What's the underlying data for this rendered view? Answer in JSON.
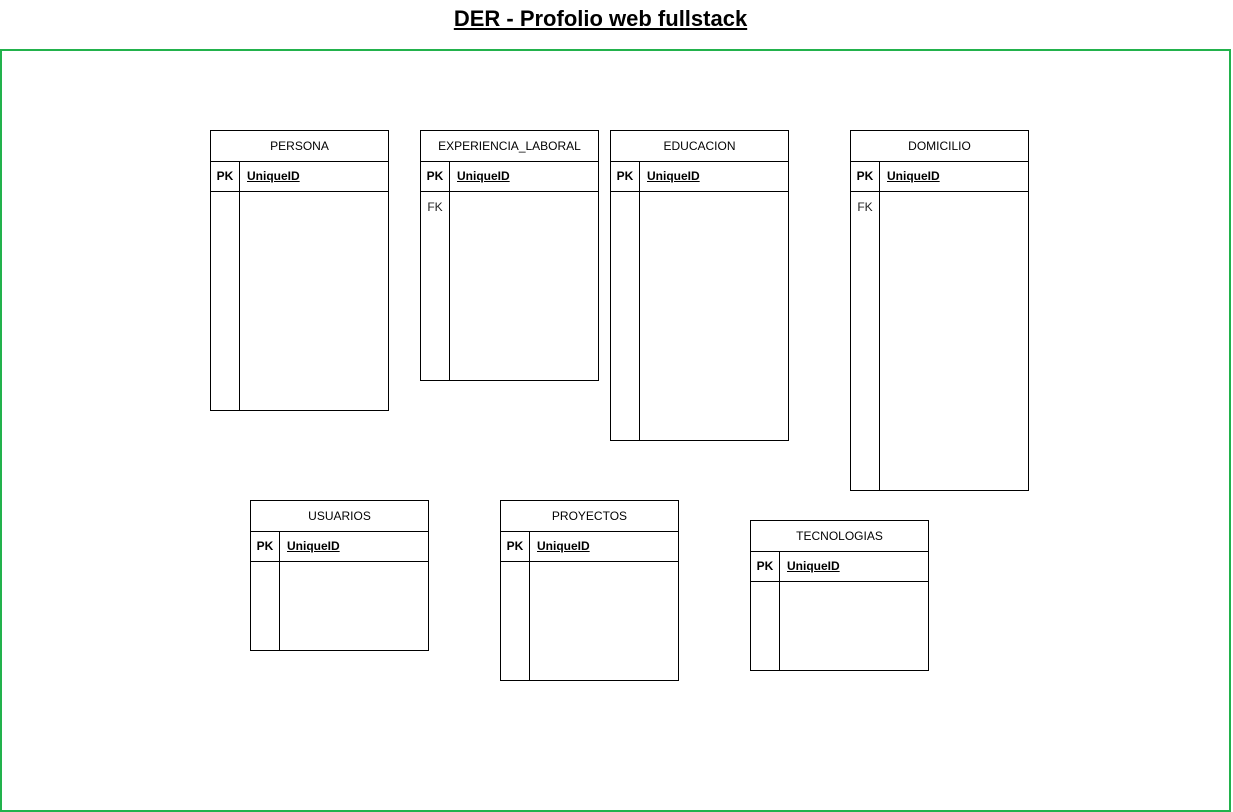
{
  "title": "DER - Profolio web fullstack",
  "colors": {
    "frame": "#22b24c",
    "stroke": "#000000"
  },
  "entities": {
    "persona": {
      "name": "PERSONA",
      "pk_label": "PK",
      "pk_field": "UniqueID",
      "fk_label": ""
    },
    "experiencia": {
      "name": "EXPERIENCIA_LABORAL",
      "pk_label": "PK",
      "pk_field": "UniqueID",
      "fk_label": "FK"
    },
    "educacion": {
      "name": "EDUCACION",
      "pk_label": "PK",
      "pk_field": "UniqueID",
      "fk_label": ""
    },
    "domicilio": {
      "name": "DOMICILIO",
      "pk_label": "PK",
      "pk_field": "UniqueID",
      "fk_label": "FK"
    },
    "usuarios": {
      "name": "USUARIOS",
      "pk_label": "PK",
      "pk_field": "UniqueID",
      "fk_label": ""
    },
    "proyectos": {
      "name": "PROYECTOS",
      "pk_label": "PK",
      "pk_field": "UniqueID",
      "fk_label": ""
    },
    "tecnologias": {
      "name": "TECNOLOGIAS",
      "pk_label": "PK",
      "pk_field": "UniqueID",
      "fk_label": ""
    }
  }
}
